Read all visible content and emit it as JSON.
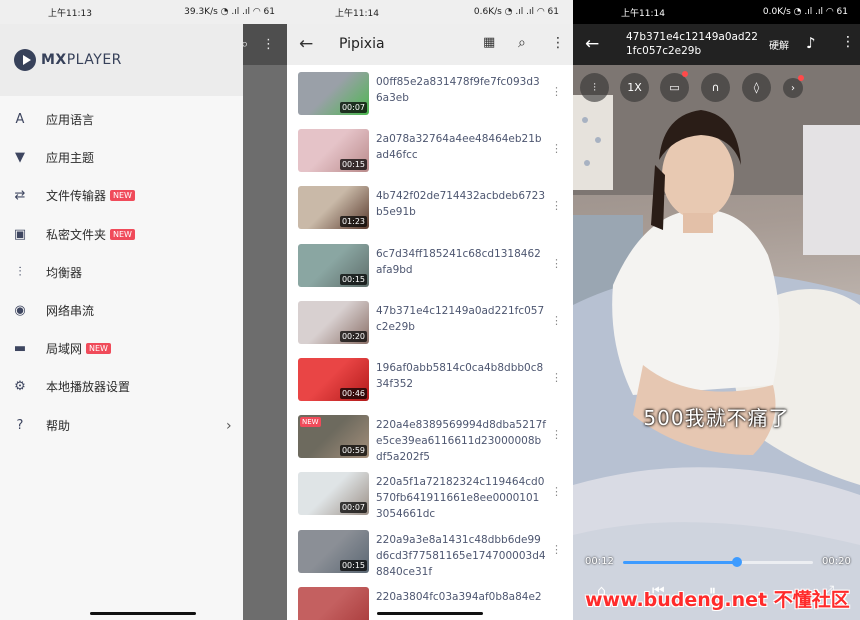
{
  "panel1": {
    "status": {
      "time": "上午11:13",
      "net": "39.3K/s",
      "battery": "61"
    },
    "brand": {
      "mx": "MX",
      "player": "PLAYER"
    },
    "menu": [
      {
        "icon": "language-icon",
        "glyph": "A",
        "label": "应用语言",
        "badge": ""
      },
      {
        "icon": "theme-shirt-icon",
        "glyph": "▼",
        "label": "应用主题",
        "badge": ""
      },
      {
        "icon": "file-transfer-icon",
        "glyph": "⇄",
        "label": "文件传输器",
        "badge": "NEW"
      },
      {
        "icon": "private-folder-icon",
        "glyph": "▣",
        "label": "私密文件夹",
        "badge": "NEW"
      },
      {
        "icon": "equalizer-icon",
        "glyph": "⫶",
        "label": "均衡器",
        "badge": ""
      },
      {
        "icon": "network-stream-icon",
        "glyph": "◉",
        "label": "网络串流",
        "badge": ""
      },
      {
        "icon": "lan-icon",
        "glyph": "▬",
        "label": "局域网",
        "badge": "NEW"
      },
      {
        "icon": "settings-gear-icon",
        "glyph": "⚙",
        "label": "本地播放器设置",
        "badge": ""
      },
      {
        "icon": "help-icon",
        "glyph": "?",
        "label": "帮助",
        "badge": ""
      }
    ],
    "chevron": "›"
  },
  "panel2": {
    "status": {
      "time": "上午11:14",
      "net": "0.6K/s",
      "battery": "61"
    },
    "title": "Pipixia",
    "videos": [
      {
        "name": "00ff85e2a831478f9fe7fc093d36a3eb",
        "duration": "00:07",
        "new": "",
        "colors": [
          "#9aa0a8",
          "#4cb84f"
        ]
      },
      {
        "name": "2a078a32764a4ee48464eb21bad46fcc",
        "duration": "00:15",
        "new": "",
        "colors": [
          "#e5c3c8",
          "#b98a8a"
        ]
      },
      {
        "name": "4b742f02de714432acbdeb6723b5e91b",
        "duration": "01:23",
        "new": "",
        "colors": [
          "#c9b9a8",
          "#5a3b2e"
        ]
      },
      {
        "name": "6c7d34ff185241c68cd1318462afa9bd",
        "duration": "00:15",
        "new": "",
        "colors": [
          "#8aa6a2",
          "#5e6d6a"
        ]
      },
      {
        "name": "47b371e4c12149a0ad221fc057c2e29b",
        "duration": "00:20",
        "new": "",
        "colors": [
          "#d8d0d0",
          "#8a6f67"
        ]
      },
      {
        "name": "196af0abb5814c0ca4b8dbb0c834f352",
        "duration": "00:46",
        "new": "",
        "colors": [
          "#e94545",
          "#b21a1a"
        ]
      },
      {
        "name": "220a4e8389569994d8dba5217fe5ce39ea6116611d23000008bdf5a202f5",
        "duration": "00:59",
        "new": "NEW",
        "colors": [
          "#6d6a5e",
          "#a48f7b"
        ]
      },
      {
        "name": "220a5f1a72182324c119464cd0570fb641911661e8ee00001013054661dc",
        "duration": "00:07",
        "new": "",
        "colors": [
          "#dfe4e6",
          "#9b8f86"
        ]
      },
      {
        "name": "220a9a3e8a1431c48dbb6de99d6cd3f77581165e174700003d48840ce31f",
        "duration": "00:15",
        "new": "",
        "colors": [
          "#8b8f96",
          "#5b6773"
        ]
      },
      {
        "name": "220a3804fc03a394af0b8a84e2",
        "duration": "",
        "new": "",
        "colors": [
          "#c46060",
          "#a83a3a"
        ]
      }
    ]
  },
  "panel3": {
    "status": {
      "time": "上午11:14",
      "net": "0.0K/s",
      "battery": "61"
    },
    "title": "47b371e4c12149a0ad221fc057c2e29b",
    "hw_decoder": "硬解",
    "speed": "1X",
    "subtitle": "500我就不痛了",
    "time_current": "00:12",
    "time_total": "00:20",
    "progress": 0.6,
    "watermark": "www.budeng.net 不懂社区"
  }
}
